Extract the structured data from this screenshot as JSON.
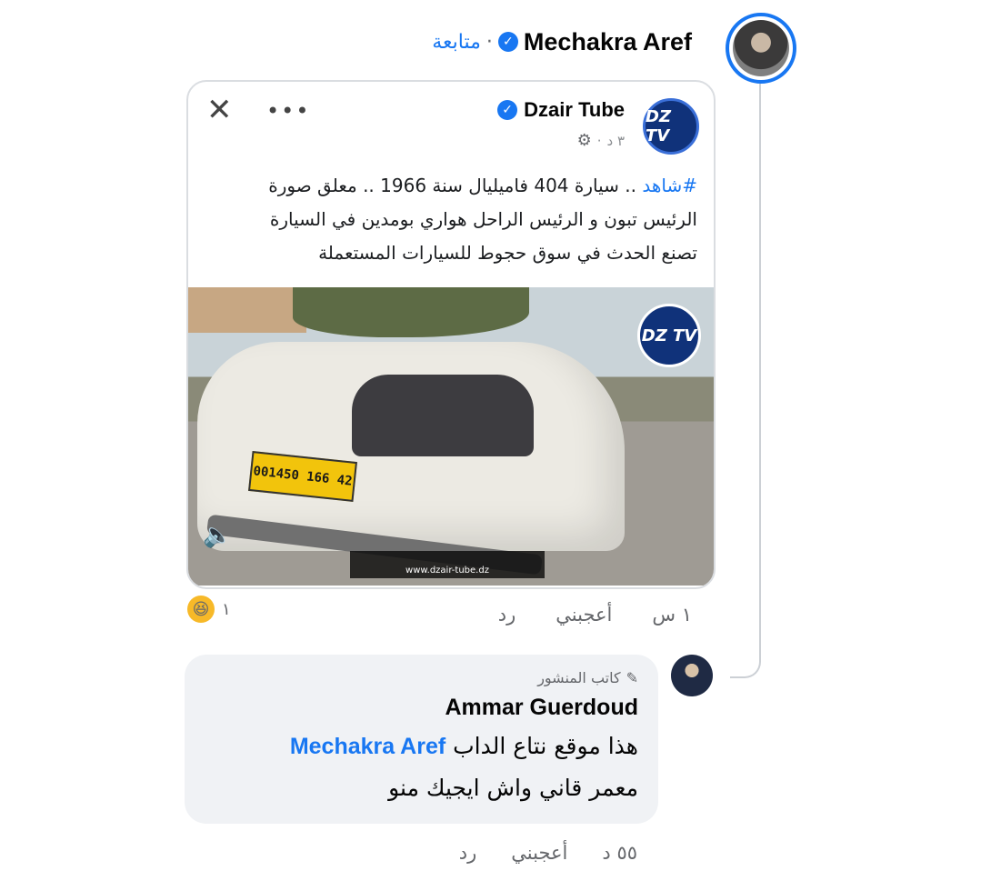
{
  "header": {
    "author": "Mechakra Aref",
    "follow_label": "متابعة",
    "separator": "·"
  },
  "shared_post": {
    "page_name": "Dzair Tube",
    "time": "٣ د",
    "more": "•••",
    "close": "✕",
    "hashtag": "#شاهد",
    "text_line1_rest": " .. سيارة 404 فاميليال سنة 1966 .. معلق صورة",
    "text_line2": "الرئيس تبون و الرئيس الراحل هواري بومدين في السيارة",
    "text_line3": "تصنع الحدث في سوق حجوط للسيارات المستعملة",
    "plate": "001450 166 42",
    "watermark_url": "www.dzair-tube.dz"
  },
  "comment1": {
    "time": "١ س",
    "like": "أعجبني",
    "reply": "رد",
    "reaction_count": "١"
  },
  "reply": {
    "badge": "كاتب المنشور",
    "name": "Ammar Guerdoud",
    "line1_text": "هذا موقع نتاع الداب ",
    "mention": "Mechakra Aref",
    "line2": "معمر قاني واش ايجيك منو",
    "time": "٥٥ د",
    "like": "أعجبني",
    "reply": "رد"
  },
  "colors": {
    "accent": "#1877f2",
    "bubble": "#f0f2f5",
    "muted": "#65676b"
  }
}
